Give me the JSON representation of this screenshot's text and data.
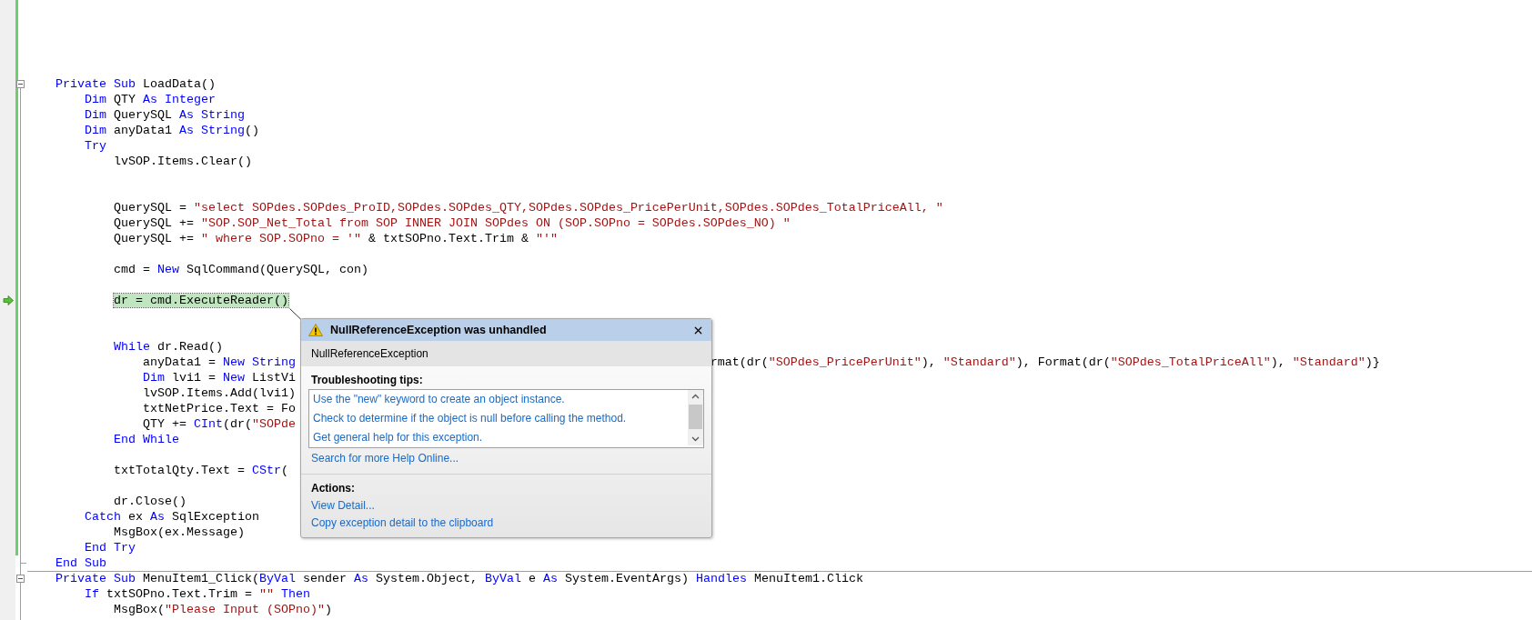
{
  "editor": {
    "lines": [
      {
        "kind": "code",
        "fold": true,
        "changed": true,
        "current": false,
        "tokens": [
          {
            "kind": "kw",
            "text": "Private Sub"
          },
          {
            "kind": "text",
            "text": " LoadData()"
          }
        ]
      },
      {
        "kind": "code",
        "changed": true,
        "current": false,
        "tokens": [
          {
            "kind": "kw",
            "text": "    Dim"
          },
          {
            "kind": "text",
            "text": " QTY "
          },
          {
            "kind": "kw",
            "text": "As Integer"
          }
        ]
      },
      {
        "kind": "code",
        "changed": true,
        "current": false,
        "tokens": [
          {
            "kind": "kw",
            "text": "    Dim"
          },
          {
            "kind": "text",
            "text": " QuerySQL "
          },
          {
            "kind": "kw",
            "text": "As String"
          }
        ]
      },
      {
        "kind": "code",
        "changed": true,
        "current": false,
        "tokens": [
          {
            "kind": "kw",
            "text": "    Dim"
          },
          {
            "kind": "text",
            "text": " anyData1 "
          },
          {
            "kind": "kw",
            "text": "As String"
          },
          {
            "kind": "text",
            "text": "()"
          }
        ]
      },
      {
        "kind": "code",
        "changed": true,
        "current": false,
        "tokens": [
          {
            "kind": "kw",
            "text": "    Try"
          }
        ]
      },
      {
        "kind": "code",
        "changed": true,
        "current": false,
        "tokens": [
          {
            "kind": "text",
            "text": "        lvSOP.Items.Clear()"
          }
        ]
      },
      {
        "kind": "blank",
        "changed": true
      },
      {
        "kind": "blank",
        "changed": true
      },
      {
        "kind": "code",
        "changed": true,
        "current": false,
        "tokens": [
          {
            "kind": "text",
            "text": "        QuerySQL = "
          },
          {
            "kind": "str",
            "text": "\"select SOPdes.SOPdes_ProID,SOPdes.SOPdes_QTY,SOPdes.SOPdes_PricePerUnit,SOPdes.SOPdes_TotalPriceAll, \""
          }
        ]
      },
      {
        "kind": "code",
        "changed": true,
        "current": false,
        "tokens": [
          {
            "kind": "text",
            "text": "        QuerySQL += "
          },
          {
            "kind": "str",
            "text": "\"SOP.SOP_Net_Total from SOP INNER JOIN SOPdes ON (SOP.SOPno = SOPdes.SOPdes_NO) \""
          }
        ]
      },
      {
        "kind": "code",
        "changed": true,
        "current": false,
        "tokens": [
          {
            "kind": "text",
            "text": "        QuerySQL += "
          },
          {
            "kind": "str",
            "text": "\" where SOP.SOPno = '\""
          },
          {
            "kind": "text",
            "text": " & txtSOPno.Text.Trim & "
          },
          {
            "kind": "str",
            "text": "\"'\""
          }
        ]
      },
      {
        "kind": "blank",
        "changed": true
      },
      {
        "kind": "code",
        "changed": true,
        "current": false,
        "tokens": [
          {
            "kind": "text",
            "text": "        cmd = "
          },
          {
            "kind": "kw",
            "text": "New"
          },
          {
            "kind": "text",
            "text": " SqlCommand(QuerySQL, con)"
          }
        ]
      },
      {
        "kind": "blank",
        "changed": true
      },
      {
        "kind": "code",
        "changed": true,
        "current": true,
        "tokens": [
          {
            "kind": "text",
            "text": "        dr = cmd.ExecuteReader()"
          }
        ]
      },
      {
        "kind": "blank",
        "changed": true
      },
      {
        "kind": "blank",
        "changed": true
      },
      {
        "kind": "code",
        "changed": true,
        "current": false,
        "tokens": [
          {
            "kind": "kw",
            "text": "        While"
          },
          {
            "kind": "text",
            "text": " dr.Read()"
          }
        ]
      },
      {
        "kind": "code",
        "changed": true,
        "current": false,
        "tokens": [
          {
            "kind": "text",
            "text": "            anyData1 = "
          },
          {
            "kind": "kw",
            "text": "New String"
          }
        ],
        "tail": [
          {
            "kind": "text",
            "text": "rmat(dr("
          },
          {
            "kind": "str",
            "text": "\"SOPdes_PricePerUnit\""
          },
          {
            "kind": "text",
            "text": "), "
          },
          {
            "kind": "str",
            "text": "\"Standard\""
          },
          {
            "kind": "text",
            "text": "), Format(dr("
          },
          {
            "kind": "str",
            "text": "\"SOPdes_TotalPriceAll\""
          },
          {
            "kind": "text",
            "text": "), "
          },
          {
            "kind": "str",
            "text": "\"Standard\""
          },
          {
            "kind": "text",
            "text": ")}"
          }
        ]
      },
      {
        "kind": "code",
        "changed": true,
        "current": false,
        "tokens": [
          {
            "kind": "kw",
            "text": "            Dim"
          },
          {
            "kind": "text",
            "text": " lvi1 = "
          },
          {
            "kind": "kw",
            "text": "New"
          },
          {
            "kind": "text",
            "text": " ListVi"
          }
        ]
      },
      {
        "kind": "code",
        "changed": true,
        "current": false,
        "tokens": [
          {
            "kind": "text",
            "text": "            lvSOP.Items.Add(lvi1)"
          }
        ]
      },
      {
        "kind": "code",
        "changed": true,
        "current": false,
        "tokens": [
          {
            "kind": "text",
            "text": "            txtNetPrice.Text = Fo"
          }
        ]
      },
      {
        "kind": "code",
        "changed": true,
        "current": false,
        "tokens": [
          {
            "kind": "text",
            "text": "            QTY += "
          },
          {
            "kind": "kw",
            "text": "CInt"
          },
          {
            "kind": "text",
            "text": "(dr("
          },
          {
            "kind": "str",
            "text": "\"SOPde"
          }
        ]
      },
      {
        "kind": "code",
        "changed": true,
        "current": false,
        "tokens": [
          {
            "kind": "kw",
            "text": "        End While"
          }
        ]
      },
      {
        "kind": "blank",
        "changed": true
      },
      {
        "kind": "code",
        "changed": true,
        "current": false,
        "tokens": [
          {
            "kind": "text",
            "text": "        txtTotalQty.Text = "
          },
          {
            "kind": "kw",
            "text": "CStr"
          },
          {
            "kind": "text",
            "text": "("
          }
        ]
      },
      {
        "kind": "blank",
        "changed": true
      },
      {
        "kind": "code",
        "changed": true,
        "current": false,
        "tokens": [
          {
            "kind": "text",
            "text": "        dr.Close()"
          }
        ]
      },
      {
        "kind": "code",
        "changed": true,
        "current": false,
        "tokens": [
          {
            "kind": "kw",
            "text": "    Catch"
          },
          {
            "kind": "text",
            "text": " ex "
          },
          {
            "kind": "kw",
            "text": "As"
          },
          {
            "kind": "text",
            "text": " SqlException"
          }
        ]
      },
      {
        "kind": "code",
        "changed": true,
        "current": false,
        "tokens": [
          {
            "kind": "text",
            "text": "        MsgBox(ex.Message)"
          }
        ]
      },
      {
        "kind": "code",
        "changed": true,
        "current": false,
        "tokens": [
          {
            "kind": "kw",
            "text": "    End Try"
          }
        ]
      },
      {
        "kind": "code",
        "fold_end": true,
        "changed": false,
        "current": false,
        "tokens": [
          {
            "kind": "kw",
            "text": "End Sub"
          }
        ]
      },
      {
        "kind": "code",
        "fold": true,
        "separator_above": true,
        "changed": false,
        "current": false,
        "tokens": [
          {
            "kind": "kw",
            "text": "Private Sub"
          },
          {
            "kind": "text",
            "text": " MenuItem1_Click("
          },
          {
            "kind": "kw",
            "text": "ByVal"
          },
          {
            "kind": "text",
            "text": " sender "
          },
          {
            "kind": "kw",
            "text": "As"
          },
          {
            "kind": "text",
            "text": " System.Object, "
          },
          {
            "kind": "kw",
            "text": "ByVal"
          },
          {
            "kind": "text",
            "text": " e "
          },
          {
            "kind": "kw",
            "text": "As"
          },
          {
            "kind": "text",
            "text": " System.EventArgs) "
          },
          {
            "kind": "kw",
            "text": "Handles"
          },
          {
            "kind": "text",
            "text": " MenuItem1.Click"
          }
        ]
      },
      {
        "kind": "code",
        "changed": false,
        "current": false,
        "tokens": [
          {
            "kind": "kw",
            "text": "    If"
          },
          {
            "kind": "text",
            "text": " txtSOPno.Text.Trim = "
          },
          {
            "kind": "str",
            "text": "\"\""
          },
          {
            "kind": "kw",
            "text": " Then"
          }
        ]
      },
      {
        "kind": "code",
        "changed": false,
        "current": false,
        "tokens": [
          {
            "kind": "text",
            "text": "        MsgBox("
          },
          {
            "kind": "str",
            "text": "\"Please Input (SOPno)\""
          },
          {
            "kind": "text",
            "text": ")"
          }
        ]
      }
    ]
  },
  "exception_popup": {
    "title": "NullReferenceException was unhandled",
    "exception_type": "NullReferenceException",
    "tips_heading": "Troubleshooting tips:",
    "tips": [
      "Use the \"new\" keyword to create an object instance.",
      "Check to determine if the object is null before calling the method.",
      "Get general help for this exception."
    ],
    "help_link": "Search for more Help Online...",
    "actions_heading": "Actions:",
    "actions": [
      "View Detail...",
      "Copy exception detail to the clipboard"
    ]
  }
}
